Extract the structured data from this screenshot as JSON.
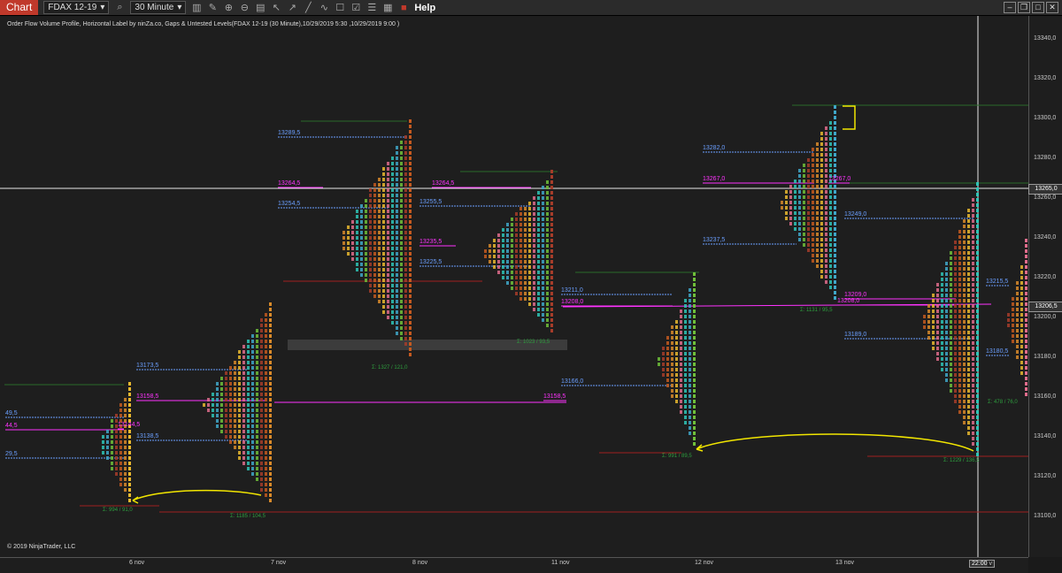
{
  "toolbar": {
    "chart_label": "Chart",
    "instrument": "FDAX 12-19",
    "interval": "30 Minute",
    "help_label": "Help",
    "icons": [
      "search-icon",
      "bar-chart-icon",
      "pencil-icon",
      "zoom-in-icon",
      "zoom-out-icon",
      "properties-icon",
      "cursor-icon",
      "arrow-icon",
      "line-icon",
      "trend-icon",
      "data-box-icon",
      "chart-trader-icon",
      "list-icon",
      "grid-icon",
      "drawing-icon"
    ]
  },
  "chart": {
    "title": "Order Flow Volume Profile, Horizontal Label by ninZa.co, Gaps & Untested Levels(FDAX 12-19 (30 Minute),10/29/2019 5:30 ,10/29/2019 9:00 )",
    "copyright": "© 2019 NinjaTrader, LLC",
    "y_axis": [
      "13340,0",
      "13320,0",
      "13300,0",
      "13280,0",
      "13260,0",
      "13240,0",
      "13220,0",
      "13200,0",
      "13180,0",
      "13160,0",
      "13140,0",
      "13120,0",
      "13100,0"
    ],
    "x_axis": [
      "6 nov",
      "7 nov",
      "8 nov",
      "11 nov",
      "12 nov",
      "13 nov"
    ],
    "current_price": "13265,0",
    "last_price": "13206,5",
    "time_tag": "22:00",
    "time_tag_suffix": "v"
  },
  "levels": [
    {
      "text": "13289,5",
      "color": "blue"
    },
    {
      "text": "13264,5",
      "color": "mag"
    },
    {
      "text": "13264,5",
      "color": "mag"
    },
    {
      "text": "13254,5",
      "color": "blue"
    },
    {
      "text": "13255,5",
      "color": "blue"
    },
    {
      "text": "13235,5",
      "color": "mag"
    },
    {
      "text": "13225,5",
      "color": "blue"
    },
    {
      "text": "13211,0",
      "color": "blue"
    },
    {
      "text": "13208,0",
      "color": "mag"
    },
    {
      "text": "13166,0",
      "color": "blue"
    },
    {
      "text": "13173,5",
      "color": "blue"
    },
    {
      "text": "13158,5",
      "color": "mag"
    },
    {
      "text": "13158,5",
      "color": "mag"
    },
    {
      "text": "13138,5",
      "color": "blue"
    },
    {
      "text": "13144,5",
      "color": "mag"
    },
    {
      "text": "49,5",
      "color": "blue"
    },
    {
      "text": "44,5",
      "color": "mag"
    },
    {
      "text": "29,5",
      "color": "blue"
    },
    {
      "text": "13282,0",
      "color": "blue"
    },
    {
      "text": "13267,0",
      "color": "mag"
    },
    {
      "text": "13267,0",
      "color": "mag"
    },
    {
      "text": "13237,5",
      "color": "blue"
    },
    {
      "text": "13249,0",
      "color": "blue"
    },
    {
      "text": "13209,0",
      "color": "mag"
    },
    {
      "text": "13208,0",
      "color": "mag"
    },
    {
      "text": "13189,0",
      "color": "blue"
    },
    {
      "text": "13215,5",
      "color": "blue"
    },
    {
      "text": "13180,5",
      "color": "blue"
    }
  ],
  "poc_labels": [
    "Σ: 994 / 91,0",
    "Σ: 1185 / 104,5",
    "Σ: 1327 / 121,0",
    "Σ: 1023 / 93,5",
    "Σ: 991 / 89,5",
    "Σ: 1131 / 95,5",
    "Σ: 1229 / 136,5",
    "Σ: 478 / 76,0"
  ],
  "colors": {
    "background": "#1e1e1e",
    "blue_level": "#6b9fff",
    "magenta_level": "#ff33ff",
    "profile": "#e8b82f"
  }
}
